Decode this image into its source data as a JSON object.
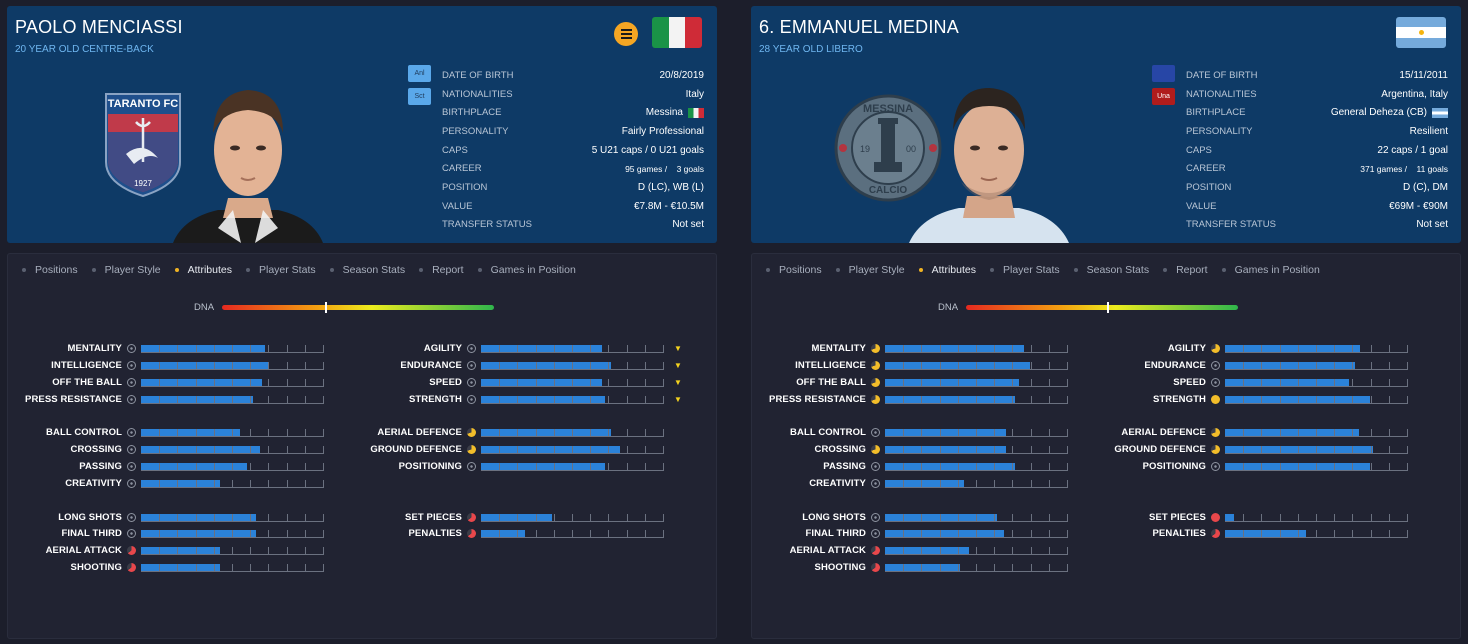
{
  "players": [
    {
      "name": "PAOLO MENCIASSI",
      "subtitle": "20 YEAR OLD CENTRE-BACK",
      "badges": [
        "Anl",
        "Sct"
      ],
      "badge_colors": [
        "#4fa3e8",
        "#4fa3e8"
      ],
      "crest_text": "TARANTO FC",
      "crest_year": "1927",
      "info": [
        {
          "label": "DATE OF BIRTH",
          "value": "20/8/2019"
        },
        {
          "label": "NATIONALITIES",
          "value": "Italy"
        },
        {
          "label": "BIRTHPLACE",
          "value": "Messina"
        },
        {
          "label": "PERSONALITY",
          "value": "Fairly Professional"
        },
        {
          "label": "CAPS",
          "value": "5 U21 caps / 0 U21 goals"
        },
        {
          "label": "CAREER",
          "value": "95 games /    3 goals"
        },
        {
          "label": "POSITION",
          "value": "D (LC), WB (L)"
        },
        {
          "label": "VALUE",
          "value": "€7.8M - €10.5M"
        },
        {
          "label": "TRANSFER STATUS",
          "value": "Not set"
        }
      ],
      "dna": 0.38,
      "attributes": {
        "left": [
          {
            "label": "MENTALITY",
            "value": 0.68,
            "icon": "neutral"
          },
          {
            "label": "INTELLIGENCE",
            "value": 0.7,
            "icon": "neutral"
          },
          {
            "label": "OFF THE BALL",
            "value": 0.66,
            "icon": "neutral"
          },
          {
            "label": "PRESS RESISTANCE",
            "value": 0.61,
            "icon": "neutral"
          },
          {
            "label": "BALL CONTROL",
            "value": 0.54,
            "icon": "neutral"
          },
          {
            "label": "CROSSING",
            "value": 0.65,
            "icon": "neutral"
          },
          {
            "label": "PASSING",
            "value": 0.58,
            "icon": "neutral"
          },
          {
            "label": "CREATIVITY",
            "value": 0.43,
            "icon": "neutral"
          },
          {
            "label": "LONG SHOTS",
            "value": 0.63,
            "icon": "neutral"
          },
          {
            "label": "FINAL THIRD",
            "value": 0.63,
            "icon": "neutral"
          },
          {
            "label": "AERIAL ATTACK",
            "value": 0.43,
            "icon": "red"
          },
          {
            "label": "SHOOTING",
            "value": 0.43,
            "icon": "red"
          }
        ],
        "right": [
          {
            "label": "AGILITY",
            "value": 0.66,
            "icon": "neutral",
            "arrow": "▼"
          },
          {
            "label": "ENDURANCE",
            "value": 0.71,
            "icon": "neutral",
            "arrow": "▼"
          },
          {
            "label": "SPEED",
            "value": 0.66,
            "icon": "neutral",
            "arrow": "▼"
          },
          {
            "label": "STRENGTH",
            "value": 0.68,
            "icon": "neutral",
            "arrow": "▼"
          },
          {
            "label": "AERIAL DEFENCE",
            "value": 0.71,
            "icon": "gold"
          },
          {
            "label": "GROUND DEFENCE",
            "value": 0.76,
            "icon": "gold"
          },
          {
            "label": "POSITIONING",
            "value": 0.68,
            "icon": "neutral"
          },
          {
            "label": "SET PIECES",
            "value": 0.39,
            "icon": "red"
          },
          {
            "label": "PENALTIES",
            "value": 0.24,
            "icon": "red"
          }
        ]
      }
    },
    {
      "name": "6. EMMANUEL MEDINA",
      "subtitle": "28 YEAR OLD LIBERO",
      "badges": [
        "",
        "Una"
      ],
      "badge_colors": [
        "#2746a6",
        "#b01c1c"
      ],
      "crest_text": "MESSINA",
      "crest_text2": "CALCIO",
      "crest_year_left": "19",
      "crest_year_right": "00",
      "info": [
        {
          "label": "DATE OF BIRTH",
          "value": "15/11/2011"
        },
        {
          "label": "NATIONALITIES",
          "value": "Argentina, Italy"
        },
        {
          "label": "BIRTHPLACE",
          "value": "General Deheza (CB)"
        },
        {
          "label": "PERSONALITY",
          "value": "Resilient"
        },
        {
          "label": "CAPS",
          "value": "22 caps / 1 goal"
        },
        {
          "label": "CAREER",
          "value": "371 games /    11 goals"
        },
        {
          "label": "POSITION",
          "value": "D (C), DM"
        },
        {
          "label": "VALUE",
          "value": "€69M - €90M"
        },
        {
          "label": "TRANSFER STATUS",
          "value": "Not set"
        }
      ],
      "dna": 0.52,
      "attributes": {
        "left": [
          {
            "label": "MENTALITY",
            "value": 0.76,
            "icon": "gold"
          },
          {
            "label": "INTELLIGENCE",
            "value": 0.79,
            "icon": "gold"
          },
          {
            "label": "OFF THE BALL",
            "value": 0.73,
            "icon": "gold"
          },
          {
            "label": "PRESS RESISTANCE",
            "value": 0.71,
            "icon": "gold"
          },
          {
            "label": "BALL CONTROL",
            "value": 0.66,
            "icon": "neutral"
          },
          {
            "label": "CROSSING",
            "value": 0.66,
            "icon": "gold"
          },
          {
            "label": "PASSING",
            "value": 0.71,
            "icon": "neutral"
          },
          {
            "label": "CREATIVITY",
            "value": 0.43,
            "icon": "neutral"
          },
          {
            "label": "LONG SHOTS",
            "value": 0.61,
            "icon": "neutral"
          },
          {
            "label": "FINAL THIRD",
            "value": 0.65,
            "icon": "neutral"
          },
          {
            "label": "AERIAL ATTACK",
            "value": 0.46,
            "icon": "red"
          },
          {
            "label": "SHOOTING",
            "value": 0.41,
            "icon": "red"
          }
        ],
        "right": [
          {
            "label": "AGILITY",
            "value": 0.74,
            "icon": "gold"
          },
          {
            "label": "ENDURANCE",
            "value": 0.71,
            "icon": "neutral"
          },
          {
            "label": "SPEED",
            "value": 0.68,
            "icon": "neutral"
          },
          {
            "label": "STRENGTH",
            "value": 0.79,
            "icon": "goldfull"
          },
          {
            "label": "AERIAL DEFENCE",
            "value": 0.73,
            "icon": "gold"
          },
          {
            "label": "GROUND DEFENCE",
            "value": 0.81,
            "icon": "gold"
          },
          {
            "label": "POSITIONING",
            "value": 0.79,
            "icon": "neutral"
          },
          {
            "label": "SET PIECES",
            "value": 0.05,
            "icon": "redfull"
          },
          {
            "label": "PENALTIES",
            "value": 0.44,
            "icon": "red"
          }
        ]
      }
    }
  ],
  "tabs": [
    "Positions",
    "Player Style",
    "Attributes",
    "Player Stats",
    "Season Stats",
    "Report",
    "Games in Position"
  ],
  "active_tab": "Attributes",
  "dna_label": "DNA",
  "colors": {
    "header_bg": "#0e3a66",
    "body_bg": "#212332",
    "bar": "#2b82d9",
    "accent": "#f0b323",
    "sub": "#6fb6f0"
  }
}
